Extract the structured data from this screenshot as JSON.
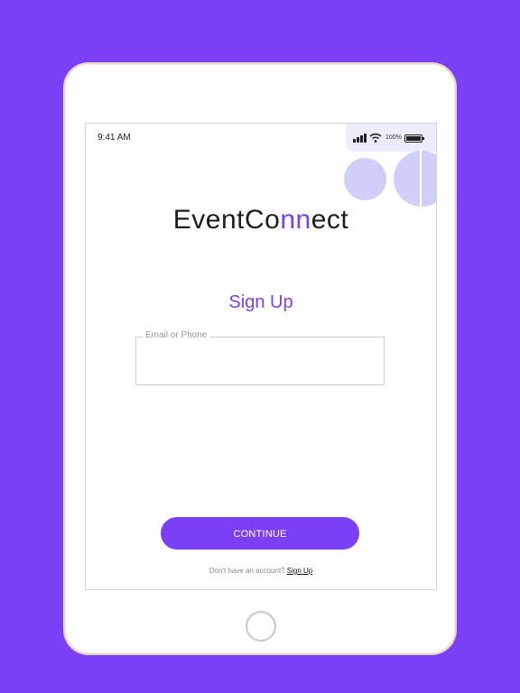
{
  "status_bar": {
    "time": "9:41 AM",
    "battery_percent": "100%"
  },
  "logo": {
    "part1": "EventCo",
    "part2": "nn",
    "part3": "ect"
  },
  "title": "Sign Up",
  "email_field": {
    "label": "Email or Phone",
    "value": ""
  },
  "continue_label": "CONTINUE",
  "footer": {
    "prompt": "Don't have an account?",
    "link": "Sign Up"
  },
  "colors": {
    "background": "#7b3ff5",
    "accent": "#7b3ff5",
    "decor": "#d0cff9"
  },
  "icons": [
    "signal-icon",
    "wifi-icon",
    "battery-icon"
  ]
}
